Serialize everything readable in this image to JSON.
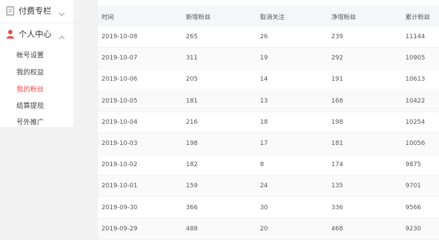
{
  "sidebar": {
    "paid_column": {
      "label": "付费专栏",
      "icon": "document-icon"
    },
    "personal_center": {
      "label": "个人中心",
      "icon": "user-icon"
    },
    "items": [
      {
        "label": "帐号设置"
      },
      {
        "label": "我的权益"
      },
      {
        "label": "我的粉丝"
      },
      {
        "label": "结算提现"
      },
      {
        "label": "号外推广"
      }
    ],
    "active_color": "#f04a4a"
  },
  "table": {
    "headers": [
      "时间",
      "新增粉丝",
      "取消关注",
      "净增粉丝",
      "累计粉丝"
    ],
    "rows": [
      [
        "2019-10-08",
        "265",
        "26",
        "239",
        "11144"
      ],
      [
        "2019-10-07",
        "311",
        "19",
        "292",
        "10905"
      ],
      [
        "2019-10-06",
        "205",
        "14",
        "191",
        "10613"
      ],
      [
        "2019-10-05",
        "181",
        "13",
        "168",
        "10422"
      ],
      [
        "2019-10-04",
        "216",
        "18",
        "198",
        "10254"
      ],
      [
        "2019-10-03",
        "198",
        "17",
        "181",
        "10056"
      ],
      [
        "2019-10-02",
        "182",
        "8",
        "174",
        "9875"
      ],
      [
        "2019-10-01",
        "159",
        "24",
        "135",
        "9701"
      ],
      [
        "2019-09-30",
        "366",
        "30",
        "336",
        "9566"
      ],
      [
        "2019-09-29",
        "488",
        "20",
        "468",
        "9230"
      ]
    ]
  }
}
